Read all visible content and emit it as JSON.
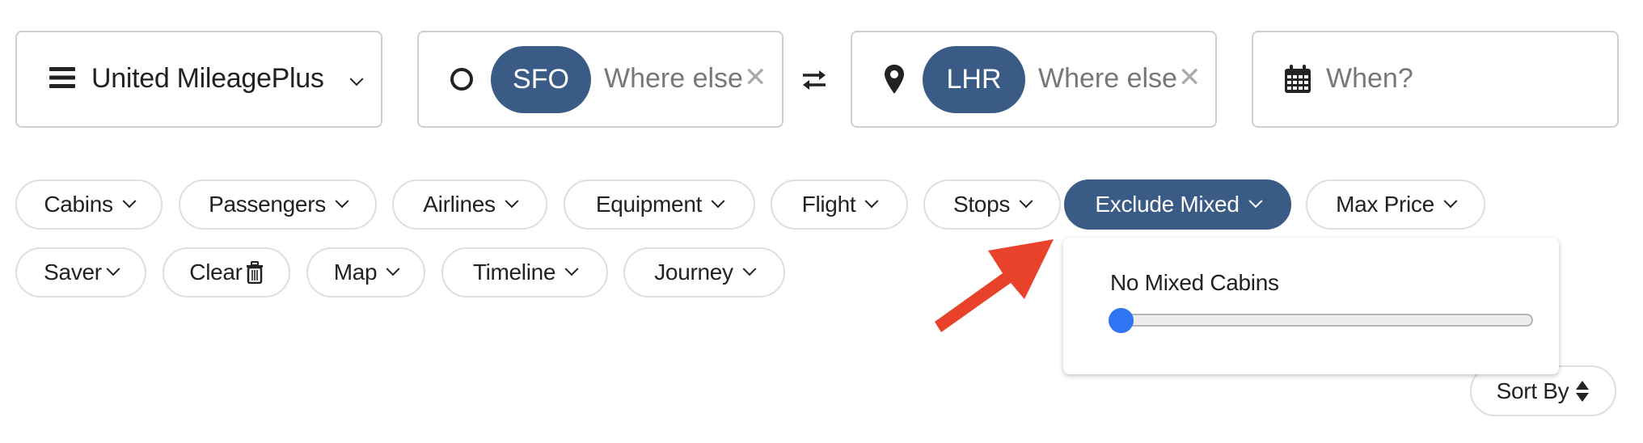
{
  "program_selector": {
    "label": "United MileagePlus",
    "icon": "hamburger-menu-icon"
  },
  "origin": {
    "icon": "circle-origin-icon",
    "code": "SFO",
    "placeholder": "Where else",
    "clear_icon": "close-icon"
  },
  "swap": {
    "icon": "swap-arrows-icon"
  },
  "destination": {
    "icon": "map-pin-icon",
    "code": "LHR",
    "placeholder": "Where else",
    "clear_icon": "close-icon"
  },
  "date": {
    "icon": "calendar-icon",
    "placeholder": "When?"
  },
  "filters": {
    "row1": [
      {
        "label": "Cabins"
      },
      {
        "label": "Passengers"
      },
      {
        "label": "Airlines"
      },
      {
        "label": "Equipment"
      },
      {
        "label": "Flight"
      },
      {
        "label": "Stops"
      },
      {
        "label": "Exclude Mixed",
        "active": true
      },
      {
        "label": "Max Price"
      }
    ],
    "row2": [
      {
        "label": "Saver"
      },
      {
        "label": "Clear",
        "icon": "trash-icon"
      },
      {
        "label": "Map"
      },
      {
        "label": "Timeline"
      },
      {
        "label": "Journey"
      }
    ]
  },
  "exclude_mixed_dropdown": {
    "label": "No Mixed Cabins",
    "slider_value": 0
  },
  "sort": {
    "label": "Sort By",
    "icon": "sort-updown-icon"
  },
  "annotation": {
    "type": "arrow",
    "color": "#e8432a"
  },
  "colors": {
    "accent": "#3a5b86",
    "slider": "#2f74f2"
  }
}
